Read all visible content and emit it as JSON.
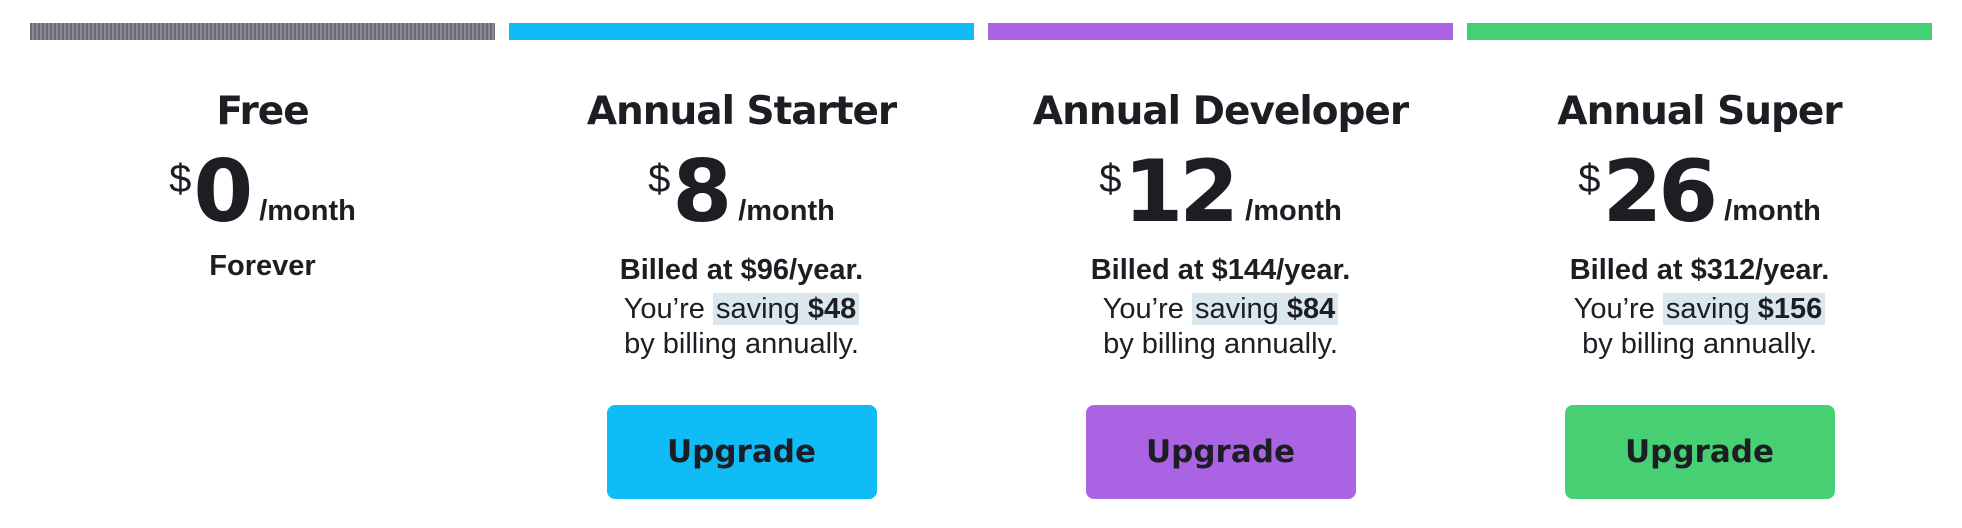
{
  "colors": {
    "free": "#7a7a85",
    "starter": "#10bcf6",
    "developer": "#aa63e3",
    "super": "#47d073",
    "text": "#1d1d24",
    "saving_highlight": "#dbe7ee"
  },
  "plans": [
    {
      "name": "Free",
      "currency": "$",
      "amount": "0",
      "period": "/month",
      "subtitle": "Forever"
    },
    {
      "name": "Annual Starter",
      "currency": "$",
      "amount": "8",
      "period": "/month",
      "billed": "Billed at $96/year.",
      "saving_prefix": "You’re",
      "saving_word": "saving",
      "saving_amount": "$48",
      "saving_suffix": "by billing annually.",
      "button_label": "Upgrade"
    },
    {
      "name": "Annual Developer",
      "currency": "$",
      "amount": "12",
      "period": "/month",
      "billed": "Billed at $144/year.",
      "saving_prefix": "You’re",
      "saving_word": "saving",
      "saving_amount": "$84",
      "saving_suffix": "by billing annually.",
      "button_label": "Upgrade"
    },
    {
      "name": "Annual Super",
      "currency": "$",
      "amount": "26",
      "period": "/month",
      "billed": "Billed at $312/year.",
      "saving_prefix": "You’re",
      "saving_word": "saving",
      "saving_amount": "$156",
      "saving_suffix": "by billing annually.",
      "button_label": "Upgrade"
    }
  ]
}
